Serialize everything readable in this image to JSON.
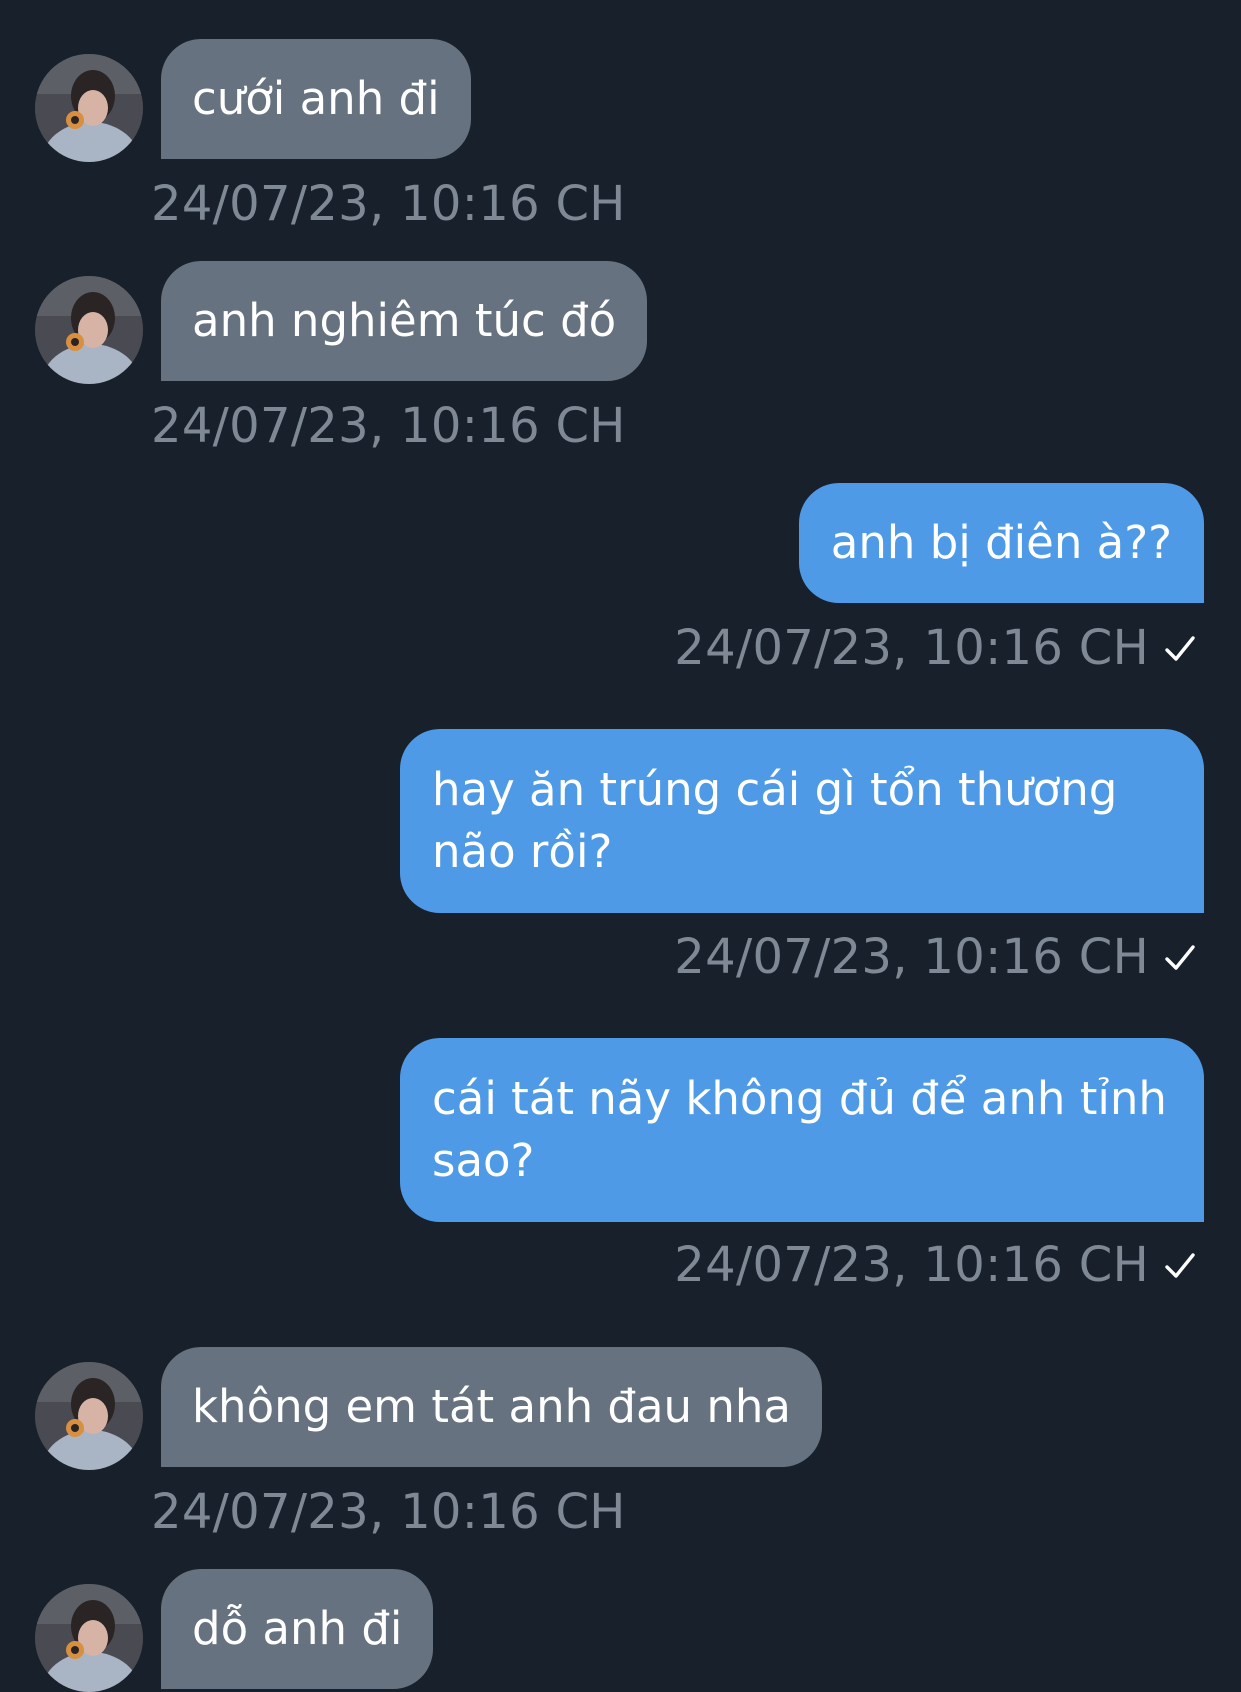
{
  "colors": {
    "background": "#18202b",
    "incoming_bubble": "#66727f",
    "outgoing_bubble": "#4f9ae6",
    "timestamp": "#7e8995",
    "text": "#ffffff"
  },
  "messages": [
    {
      "direction": "incoming",
      "text": "cưới anh đi",
      "time": "24/07/23, 10:16 CH"
    },
    {
      "direction": "incoming",
      "text": "anh nghiêm túc đó",
      "time": "24/07/23, 10:16 CH"
    },
    {
      "direction": "outgoing",
      "text": "anh bị điên à??",
      "time": "24/07/23, 10:16 CH",
      "status_icon": "checkmark-icon"
    },
    {
      "direction": "outgoing",
      "text": "hay ăn trúng cái gì tổn thương não rồi?",
      "time": "24/07/23, 10:16 CH",
      "status_icon": "checkmark-icon"
    },
    {
      "direction": "outgoing",
      "text": "cái tát nãy không đủ để anh tỉnh sao?",
      "time": "24/07/23, 10:16 CH",
      "status_icon": "checkmark-icon"
    },
    {
      "direction": "incoming",
      "text": "không em tát anh đau nha",
      "time": "24/07/23, 10:16 CH"
    },
    {
      "direction": "incoming",
      "text": "dỗ anh đi"
    }
  ]
}
